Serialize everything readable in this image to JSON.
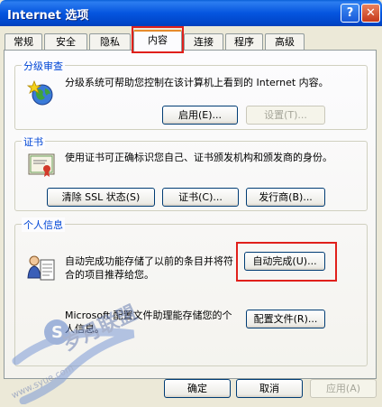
{
  "window": {
    "title": "Internet 选项"
  },
  "tabs": [
    {
      "label": "常规"
    },
    {
      "label": "安全"
    },
    {
      "label": "隐私"
    },
    {
      "label": "内容"
    },
    {
      "label": "连接"
    },
    {
      "label": "程序"
    },
    {
      "label": "高级"
    }
  ],
  "active_tab": "内容",
  "content_advisor": {
    "group_label": "分级审查",
    "description": "分级系统可帮助您控制在该计算机上看到的 Internet 内容。",
    "enable_button": "启用(E)...",
    "settings_button": "设置(T)..."
  },
  "certificates": {
    "group_label": "证书",
    "description": "使用证书可正确标识您自己、证书颁发机构和颁发商的身份。",
    "clear_ssl_button": "清除 SSL 状态(S)",
    "certificates_button": "证书(C)...",
    "publishers_button": "发行商(B)..."
  },
  "personal_info": {
    "group_label": "个人信息",
    "autocomplete_description": "自动完成功能存储了以前的条目并将符合的项目推荐给您。",
    "autocomplete_button": "自动完成(U)...",
    "profile_description": "Microsoft 配置文件助理能存储您的个人信息。",
    "profile_button": "配置文件(R)..."
  },
  "footer": {
    "ok_button": "确定",
    "cancel_button": "取消",
    "apply_button": "应用(A)"
  },
  "watermark": {
    "main_text": "岁月联盟",
    "sub_text": "www.syue.com"
  },
  "colors": {
    "titlebar": "#0555df",
    "highlight": "#e0201b",
    "group_label": "#0046d5",
    "dialog_bg": "#ece9d8"
  }
}
